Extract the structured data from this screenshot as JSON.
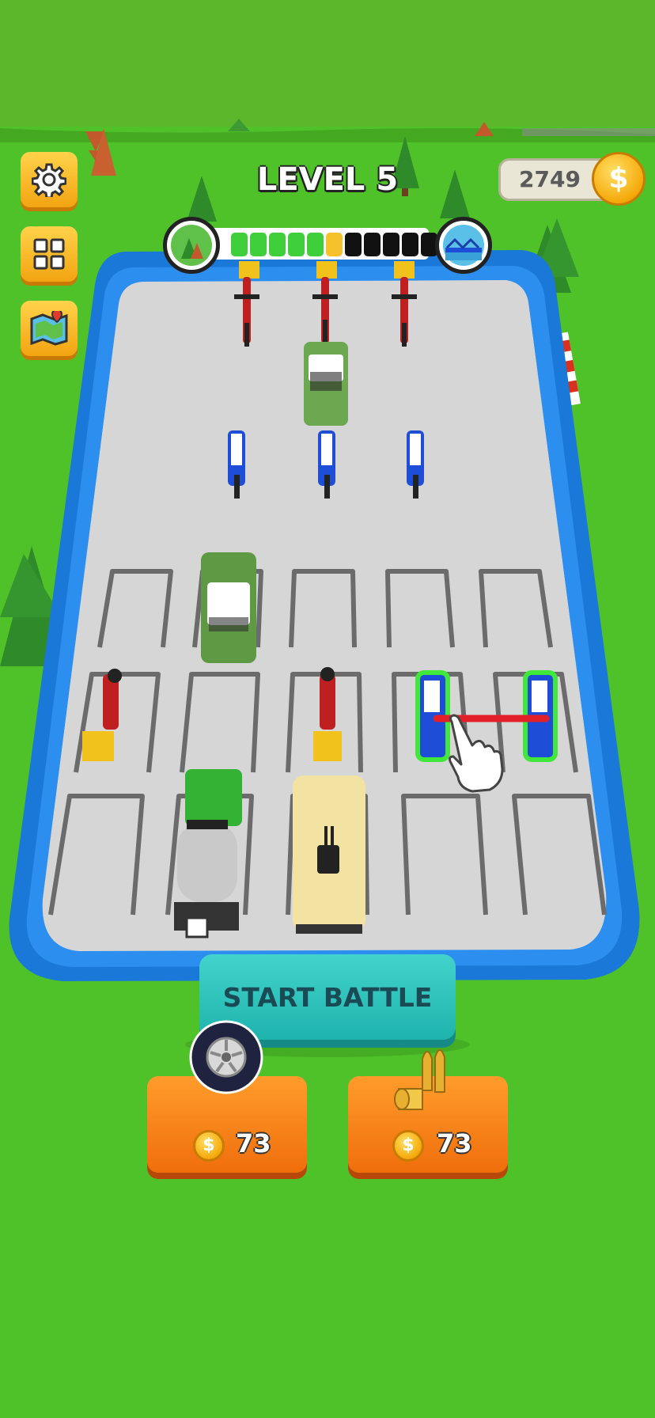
{
  "hud": {
    "level_label": "LEVEL 5",
    "coins": "2749"
  },
  "progress": {
    "total_segments": 11,
    "filled_green": 5,
    "current_index": 5,
    "colors": {
      "green": "#3fcf3a",
      "current": "#f6c12a",
      "empty": "#111111"
    },
    "start_icon": "forest-icon",
    "end_icon": "bridge-icon"
  },
  "side_buttons": [
    {
      "name": "settings-button",
      "icon": "gear-icon"
    },
    {
      "name": "collection-button",
      "icon": "grid-icon"
    },
    {
      "name": "map-button",
      "icon": "map-icon"
    }
  ],
  "actions": {
    "start_battle_label": "START BATTLE"
  },
  "shop": [
    {
      "item": "tire",
      "icon": "tire-icon",
      "price": "73"
    },
    {
      "item": "bullets",
      "icon": "bullets-icon",
      "price": "73"
    }
  ],
  "tutorial": {
    "hint": "drag-to-merge",
    "icon": "pointing-hand-icon"
  },
  "colors": {
    "grass": "#4fc22a",
    "sky": "#5cb82a",
    "arena_border": "#1a78d8",
    "arena_floor": "#d6d6d6"
  }
}
